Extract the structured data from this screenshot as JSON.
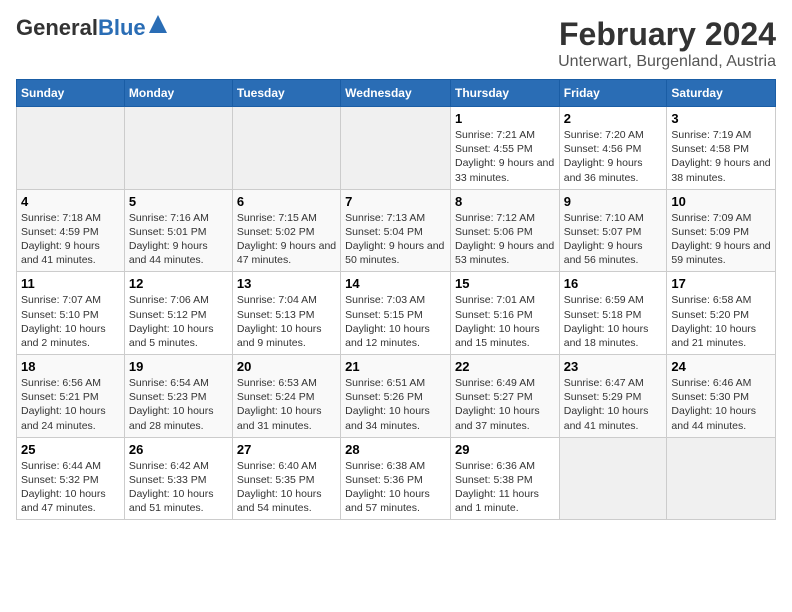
{
  "logo": {
    "general": "General",
    "blue": "Blue"
  },
  "header": {
    "title": "February 2024",
    "subtitle": "Unterwart, Burgenland, Austria"
  },
  "days_of_week": [
    "Sunday",
    "Monday",
    "Tuesday",
    "Wednesday",
    "Thursday",
    "Friday",
    "Saturday"
  ],
  "weeks": [
    [
      {
        "day": "",
        "info": ""
      },
      {
        "day": "",
        "info": ""
      },
      {
        "day": "",
        "info": ""
      },
      {
        "day": "",
        "info": ""
      },
      {
        "day": "1",
        "info": "Sunrise: 7:21 AM\nSunset: 4:55 PM\nDaylight: 9 hours and 33 minutes."
      },
      {
        "day": "2",
        "info": "Sunrise: 7:20 AM\nSunset: 4:56 PM\nDaylight: 9 hours and 36 minutes."
      },
      {
        "day": "3",
        "info": "Sunrise: 7:19 AM\nSunset: 4:58 PM\nDaylight: 9 hours and 38 minutes."
      }
    ],
    [
      {
        "day": "4",
        "info": "Sunrise: 7:18 AM\nSunset: 4:59 PM\nDaylight: 9 hours and 41 minutes."
      },
      {
        "day": "5",
        "info": "Sunrise: 7:16 AM\nSunset: 5:01 PM\nDaylight: 9 hours and 44 minutes."
      },
      {
        "day": "6",
        "info": "Sunrise: 7:15 AM\nSunset: 5:02 PM\nDaylight: 9 hours and 47 minutes."
      },
      {
        "day": "7",
        "info": "Sunrise: 7:13 AM\nSunset: 5:04 PM\nDaylight: 9 hours and 50 minutes."
      },
      {
        "day": "8",
        "info": "Sunrise: 7:12 AM\nSunset: 5:06 PM\nDaylight: 9 hours and 53 minutes."
      },
      {
        "day": "9",
        "info": "Sunrise: 7:10 AM\nSunset: 5:07 PM\nDaylight: 9 hours and 56 minutes."
      },
      {
        "day": "10",
        "info": "Sunrise: 7:09 AM\nSunset: 5:09 PM\nDaylight: 9 hours and 59 minutes."
      }
    ],
    [
      {
        "day": "11",
        "info": "Sunrise: 7:07 AM\nSunset: 5:10 PM\nDaylight: 10 hours and 2 minutes."
      },
      {
        "day": "12",
        "info": "Sunrise: 7:06 AM\nSunset: 5:12 PM\nDaylight: 10 hours and 5 minutes."
      },
      {
        "day": "13",
        "info": "Sunrise: 7:04 AM\nSunset: 5:13 PM\nDaylight: 10 hours and 9 minutes."
      },
      {
        "day": "14",
        "info": "Sunrise: 7:03 AM\nSunset: 5:15 PM\nDaylight: 10 hours and 12 minutes."
      },
      {
        "day": "15",
        "info": "Sunrise: 7:01 AM\nSunset: 5:16 PM\nDaylight: 10 hours and 15 minutes."
      },
      {
        "day": "16",
        "info": "Sunrise: 6:59 AM\nSunset: 5:18 PM\nDaylight: 10 hours and 18 minutes."
      },
      {
        "day": "17",
        "info": "Sunrise: 6:58 AM\nSunset: 5:20 PM\nDaylight: 10 hours and 21 minutes."
      }
    ],
    [
      {
        "day": "18",
        "info": "Sunrise: 6:56 AM\nSunset: 5:21 PM\nDaylight: 10 hours and 24 minutes."
      },
      {
        "day": "19",
        "info": "Sunrise: 6:54 AM\nSunset: 5:23 PM\nDaylight: 10 hours and 28 minutes."
      },
      {
        "day": "20",
        "info": "Sunrise: 6:53 AM\nSunset: 5:24 PM\nDaylight: 10 hours and 31 minutes."
      },
      {
        "day": "21",
        "info": "Sunrise: 6:51 AM\nSunset: 5:26 PM\nDaylight: 10 hours and 34 minutes."
      },
      {
        "day": "22",
        "info": "Sunrise: 6:49 AM\nSunset: 5:27 PM\nDaylight: 10 hours and 37 minutes."
      },
      {
        "day": "23",
        "info": "Sunrise: 6:47 AM\nSunset: 5:29 PM\nDaylight: 10 hours and 41 minutes."
      },
      {
        "day": "24",
        "info": "Sunrise: 6:46 AM\nSunset: 5:30 PM\nDaylight: 10 hours and 44 minutes."
      }
    ],
    [
      {
        "day": "25",
        "info": "Sunrise: 6:44 AM\nSunset: 5:32 PM\nDaylight: 10 hours and 47 minutes."
      },
      {
        "day": "26",
        "info": "Sunrise: 6:42 AM\nSunset: 5:33 PM\nDaylight: 10 hours and 51 minutes."
      },
      {
        "day": "27",
        "info": "Sunrise: 6:40 AM\nSunset: 5:35 PM\nDaylight: 10 hours and 54 minutes."
      },
      {
        "day": "28",
        "info": "Sunrise: 6:38 AM\nSunset: 5:36 PM\nDaylight: 10 hours and 57 minutes."
      },
      {
        "day": "29",
        "info": "Sunrise: 6:36 AM\nSunset: 5:38 PM\nDaylight: 11 hours and 1 minute."
      },
      {
        "day": "",
        "info": ""
      },
      {
        "day": "",
        "info": ""
      }
    ]
  ]
}
